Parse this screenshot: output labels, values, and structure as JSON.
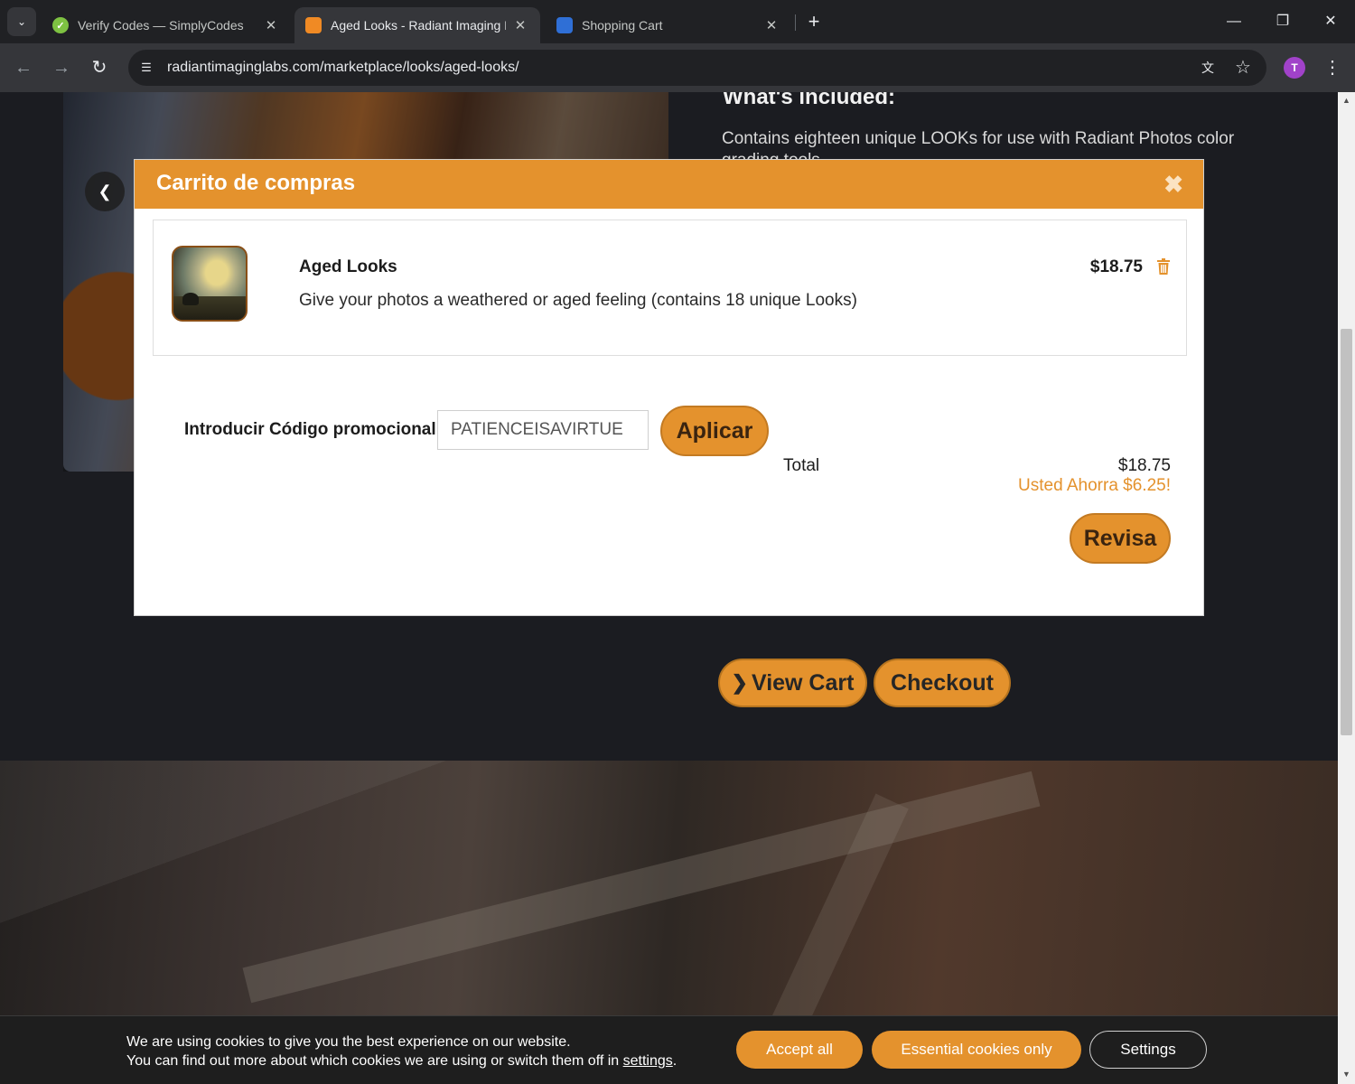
{
  "browser": {
    "tabs": [
      {
        "title": "Verify Codes — SimplyCodes",
        "active": false,
        "favicon_color": "#7ec242"
      },
      {
        "title": "Aged Looks - Radiant Imaging L",
        "active": true,
        "favicon_color": "#f08a24"
      },
      {
        "title": "Shopping Cart",
        "active": false,
        "favicon_color": "#2f6fd6"
      }
    ],
    "url": "radiantimaginglabs.com/marketplace/looks/aged-looks/",
    "profile_initial": "T"
  },
  "page": {
    "included_title": "What's included:",
    "included_text": "Contains eighteen unique LOOKs for use with Radiant Photos color grading tools.",
    "view_cart_label": "View Cart",
    "checkout_label": "Checkout"
  },
  "modal": {
    "title": "Carrito de compras",
    "item": {
      "name": "Aged Looks",
      "description": "Give your photos a weathered or aged feeling (contains 18 unique Looks)",
      "price": "$18.75"
    },
    "promo_label": "Introducir Código promocional",
    "promo_value": "PATIENCEISAVIRTUE",
    "apply_label": "Aplicar",
    "total_label": "Total",
    "total_value": "$18.75",
    "savings_text": "Usted Ahorra $6.25!",
    "review_label": "Revisa"
  },
  "cookies": {
    "line1": "We are using cookies to give you the best experience on our website.",
    "line2_prefix": "You can find out more about which cookies we are using or switch them off in ",
    "line2_link": "settings",
    "line2_suffix": ".",
    "accept_label": "Accept all",
    "essential_label": "Essential cookies only",
    "settings_label": "Settings"
  },
  "colors": {
    "accent": "#e4922d",
    "chrome_dark": "#202124",
    "page_bg": "#1b1c21"
  }
}
